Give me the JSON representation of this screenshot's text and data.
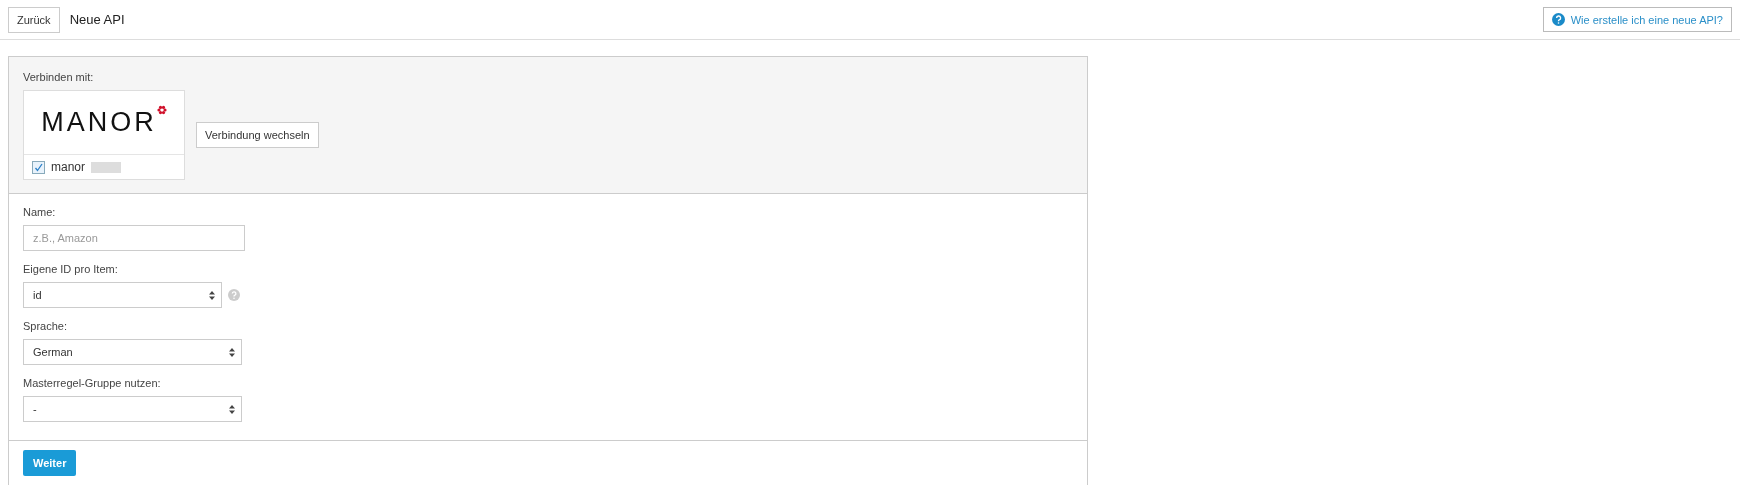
{
  "header": {
    "back_button": "Zurück",
    "title": "Neue API",
    "help_link": "Wie erstelle ich eine neue API?"
  },
  "connect": {
    "label": "Verbinden mit:",
    "logo_text": "MANOR",
    "account": {
      "name": "manor",
      "checked": true
    },
    "switch_button": "Verbindung wechseln"
  },
  "fields": [
    {
      "kind": "text",
      "label": "Name:",
      "placeholder": "z.B., Amazon",
      "help": false
    },
    {
      "kind": "select",
      "label": "Eigene ID pro Item:",
      "value": "id",
      "help": true
    },
    {
      "kind": "select",
      "label": "Sprache:",
      "value": "German",
      "help": false
    },
    {
      "kind": "select",
      "label": "Masterregel-Gruppe nutzen:",
      "value": "-",
      "help": false
    }
  ],
  "submit_button": "Weiter"
}
